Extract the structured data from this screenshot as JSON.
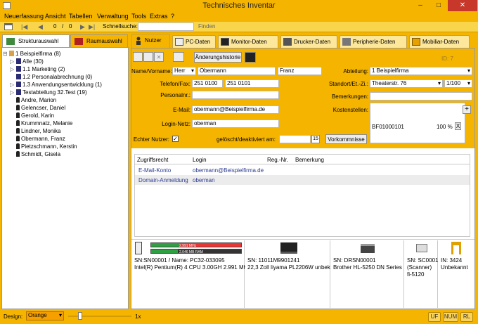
{
  "window": {
    "title": "Technisches Inventar",
    "min": "–",
    "max": "□",
    "close": "✕"
  },
  "menu": [
    "Neuerfassung",
    "Ansicht",
    "Tabellen",
    "Verwaltung",
    "Tools",
    "Extras",
    "?"
  ],
  "toolbar": {
    "page_current": "0",
    "page_sep": "/",
    "page_total": "0",
    "quicksearch_label": "Schnellsuche:",
    "find_label": "Finden"
  },
  "left_tabs": {
    "structure": "Strukturauswahl",
    "rooms": "Raumauswahl"
  },
  "tree": [
    {
      "label": "1 Beispielfirma (8)",
      "level": 0,
      "exp": "⊟",
      "kind": "folder"
    },
    {
      "label": "Alle (30)",
      "level": 1,
      "exp": "▷",
      "kind": "group"
    },
    {
      "label": "1.1 Marketing (2)",
      "level": 1,
      "exp": "▷",
      "kind": "group"
    },
    {
      "label": "1.2 Personalabrechnung (0)",
      "level": 1,
      "exp": "",
      "kind": "group"
    },
    {
      "label": "1.3 Anwendungsentwicklung (1)",
      "level": 1,
      "exp": "▷",
      "kind": "group"
    },
    {
      "label": "Testabteilung 32.Test (19)",
      "level": 1,
      "exp": "▷",
      "kind": "group"
    },
    {
      "label": "Andre, Marion",
      "level": 1,
      "exp": "",
      "kind": "user"
    },
    {
      "label": "Gelencser, Daniel",
      "level": 1,
      "exp": "",
      "kind": "user"
    },
    {
      "label": "Gerold, Karin",
      "level": 1,
      "exp": "",
      "kind": "user"
    },
    {
      "label": "Krummnatz, Melanie",
      "level": 1,
      "exp": "",
      "kind": "user"
    },
    {
      "label": "Lindner, Monika",
      "level": 1,
      "exp": "",
      "kind": "user"
    },
    {
      "label": "Obermann, Franz",
      "level": 1,
      "exp": "",
      "kind": "user"
    },
    {
      "label": "Pietzschmann, Kerstin",
      "level": 1,
      "exp": "",
      "kind": "user"
    },
    {
      "label": "Schmidt, Gisela",
      "level": 1,
      "exp": "",
      "kind": "user"
    }
  ],
  "tabs": [
    "Nutzer",
    "PC-Daten",
    "Monitor-Daten",
    "Drucker-Daten",
    "Peripherie-Daten",
    "Mobiliar-Daten"
  ],
  "form_toolbar": {
    "history_button": "Änderungshistorie",
    "id_label": "ID: 7"
  },
  "form": {
    "name_label": "Name/Vorname:",
    "salutation": "Herr",
    "lastname": "Obermann",
    "firstname": "Franz",
    "phone_label": "Telefon/Fax:",
    "phone": "251 0100",
    "fax": "251 0101",
    "personnel_label": "Personalnr.:",
    "personnel": "",
    "email_label": "E-Mail:",
    "email": "obermann@Beispielfirma.de",
    "login_label": "Login-Netz:",
    "login": "oberman",
    "real_user_label": "Echter Nutzer:",
    "deleted_label": "gelöscht/deaktiviert am:",
    "deleted_date": "",
    "calendar_day": "15",
    "events_button": "Vorkommnisse",
    "department_label": "Abteilung:",
    "department": "1 Beispielfirma",
    "location_label": "Standort/Et.-Zi.:",
    "location": "Theaterstr. 76",
    "room": "1/100",
    "remarks_label": "Bemerkungen:",
    "remarks": "",
    "costcenter_label": "Kostenstellen:",
    "costcenter_code": "BF01000101",
    "costcenter_pct": "100 %",
    "costcenter_remove": "X",
    "costcenter_add": "+"
  },
  "access": {
    "title": "Zugriffsrechte/Gruppenmitgliedschaft",
    "headers": [
      "Zugriffsrecht",
      "Login",
      "Reg.-Nr.",
      "Bemerkung"
    ],
    "rows": [
      {
        "right": "E-Mail-Konto",
        "login": "obermann@Beispielfirma.de",
        "reg": "",
        "note": ""
      },
      {
        "right": "Domain-Anmeldung",
        "login": "oberman",
        "reg": "",
        "note": ""
      }
    ]
  },
  "hardware": [
    {
      "line1": "SN:SN00001 / Name: PC32-033095",
      "line2": "Intel(R) Pentium(R) 4 CPU 3.00GH 2.991 MHz",
      "bar1": "2.991 MHz",
      "bar2": "2.046 MB RAM",
      "bar1_fill": 0.32,
      "bar2_fill": 0.3
    },
    {
      "line1": "SN: 11011M9901241",
      "line2": "22,3 Zoll Iiyama PL2206W unbek"
    },
    {
      "line1": "SN: DRSN00001",
      "line2": "Brother HL-5250 DN Series"
    },
    {
      "line1": "SN: SC0001",
      "line2": "(Scanner)",
      "line3": "fi-5120"
    },
    {
      "line1": "IN: 3424",
      "line2": "Unbekannt"
    }
  ],
  "status": {
    "design_label": "Design:",
    "design_value": "Orange",
    "zoom": "1x",
    "uf": "UF",
    "num": "NUM",
    "rl": "RL"
  },
  "colors": {
    "accent": "#f5b400",
    "link": "#2a3a8f"
  }
}
